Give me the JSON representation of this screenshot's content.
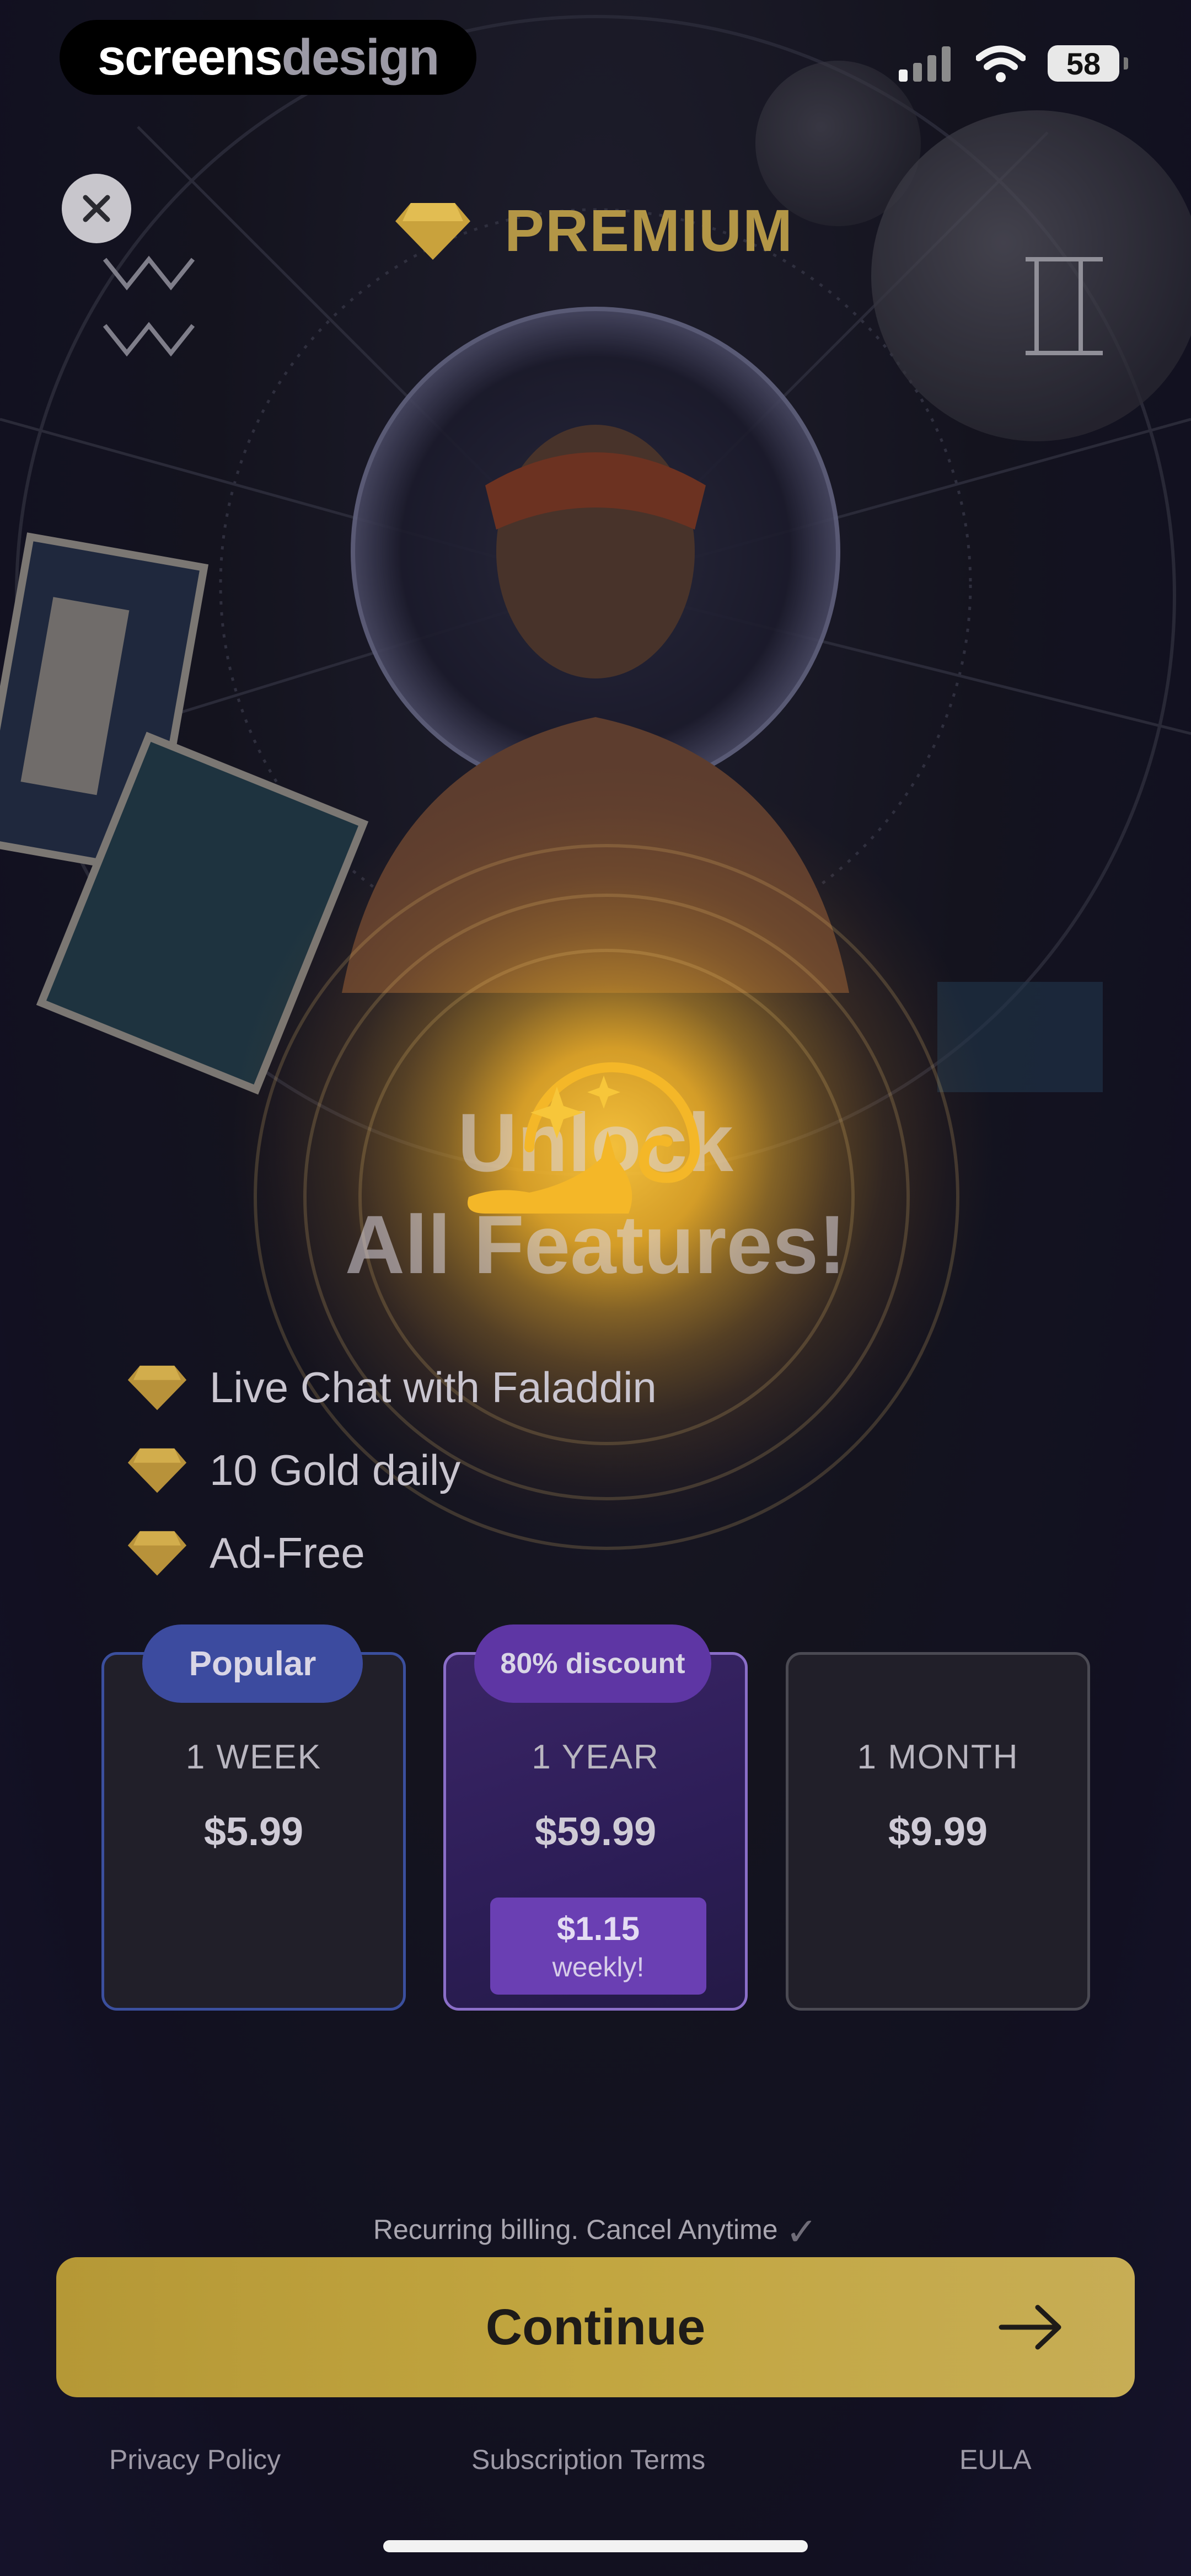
{
  "watermark": {
    "part1": "screens",
    "part2": "design"
  },
  "status_bar": {
    "battery": "58"
  },
  "header": {
    "title": "PREMIUM"
  },
  "hero": {
    "line1": "Unlock",
    "line2": "All Features!"
  },
  "features": [
    {
      "label": "Live Chat with Faladdin"
    },
    {
      "label": "10 Gold daily"
    },
    {
      "label": "Ad-Free"
    }
  ],
  "plans": [
    {
      "badge": "Popular",
      "name": "1 WEEK",
      "price": "$5.99"
    },
    {
      "badge": "80% discount",
      "name": "1 YEAR",
      "price": "$59.99",
      "weekly_price": "$1.15",
      "weekly_label": "weekly!"
    },
    {
      "name": "1 MONTH",
      "price": "$9.99"
    }
  ],
  "billing_note": "Recurring billing. Cancel Anytime",
  "cta": {
    "label": "Continue"
  },
  "footer": {
    "privacy": "Privacy Policy",
    "terms": "Subscription Terms",
    "eula": "EULA"
  },
  "colors": {
    "gold": "#c2a640",
    "purple": "#5e36a4",
    "blue": "#3c4b9f",
    "background": "#1b1a26"
  },
  "icons": [
    "close-icon",
    "diamond-icon",
    "lamp-icon",
    "arrow-right-icon",
    "wifi-icon",
    "signal-icon",
    "check-icon"
  ]
}
